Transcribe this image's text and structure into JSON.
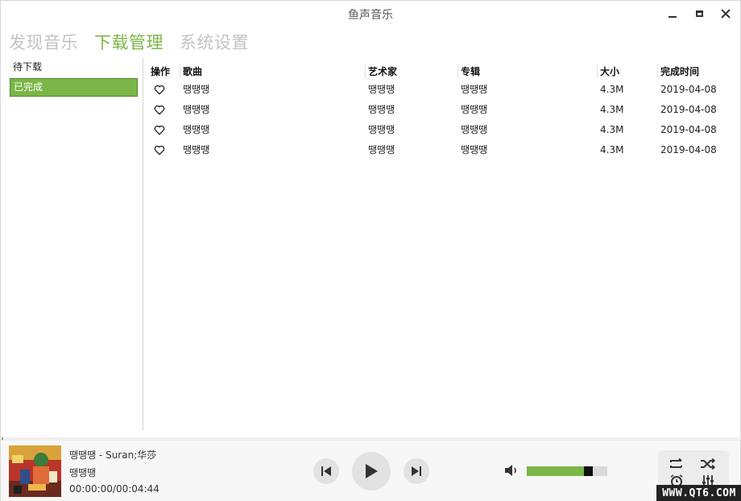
{
  "app": {
    "title": "鱼声音乐"
  },
  "nav": {
    "items": [
      {
        "label": "发现音乐",
        "active": false
      },
      {
        "label": "下载管理",
        "active": true
      },
      {
        "label": "系统设置",
        "active": false
      }
    ]
  },
  "sidebar": {
    "items": [
      {
        "label": "待下载",
        "selected": false
      },
      {
        "label": "已完成",
        "selected": true
      }
    ]
  },
  "table": {
    "headers": {
      "action": "操作",
      "song": "歌曲",
      "artist": "艺术家",
      "album": "专辑",
      "size": "大小",
      "completed": "完成时间"
    },
    "rows": [
      {
        "song": "땡땡땡",
        "artist": "땡땡땡",
        "album": "땡땡땡",
        "size": "4.3M",
        "completed": "2019-04-08"
      },
      {
        "song": "땡땡땡",
        "artist": "땡땡땡",
        "album": "땡땡땡",
        "size": "4.3M",
        "completed": "2019-04-08"
      },
      {
        "song": "땡땡땡",
        "artist": "땡땡땡",
        "album": "땡땡땡",
        "size": "4.3M",
        "completed": "2019-04-08"
      },
      {
        "song": "땡땡땡",
        "artist": "땡땡땡",
        "album": "땡땡땡",
        "size": "4.3M",
        "completed": "2019-04-08"
      }
    ]
  },
  "player": {
    "song_line": "땡땡땡 - Suran;华莎",
    "album_line": "땡땡땡",
    "time": "00:00:00/00:04:44",
    "progress_fraction": 0.002,
    "volume_fraction": 0.8
  },
  "watermark": "WWW.QT6.COM",
  "colors": {
    "accent": "#7ab648",
    "nav_inactive": "#c3c3c3"
  },
  "icons": {
    "row_action": "heart-icon",
    "prev": "skip-previous-icon",
    "play": "play-icon",
    "next": "skip-next-icon",
    "volume": "volume-icon",
    "repeat": "repeat-icon",
    "shuffle": "shuffle-icon",
    "alarm": "alarm-icon",
    "equalizer": "equalizer-icon"
  }
}
